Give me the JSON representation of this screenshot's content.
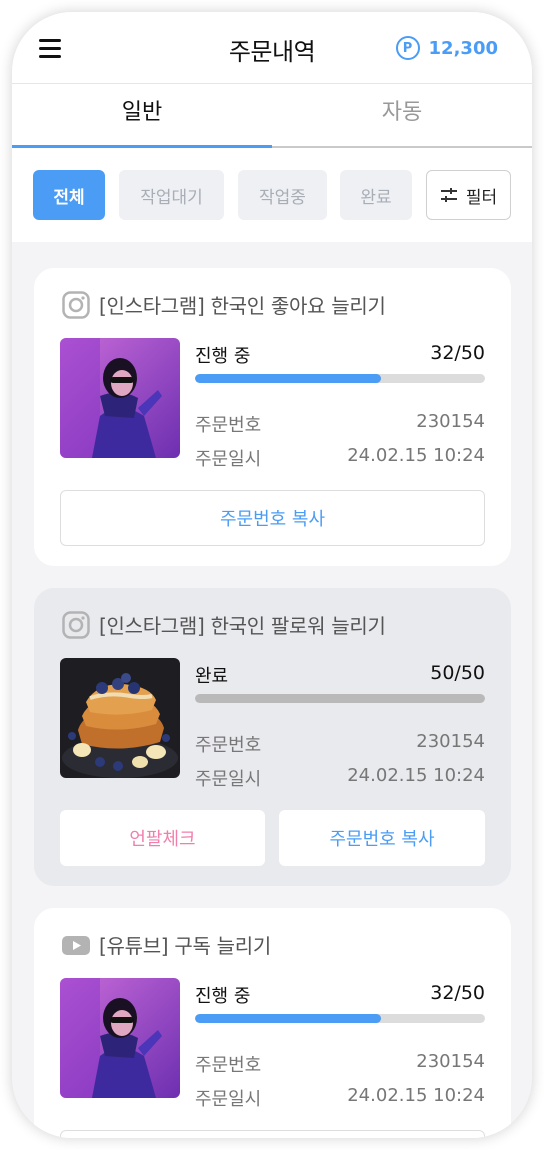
{
  "header": {
    "title": "주문내역",
    "points_icon": "P",
    "points": "12,300"
  },
  "tabs": [
    {
      "label": "일반",
      "active": true
    },
    {
      "label": "자동",
      "active": false
    }
  ],
  "filters": {
    "chips": [
      {
        "label": "전체",
        "active": true
      },
      {
        "label": "작업대기",
        "active": false
      },
      {
        "label": "작업중",
        "active": false
      },
      {
        "label": "완료",
        "active": false
      }
    ],
    "filter_label": "필터"
  },
  "orders": [
    {
      "platform_icon": "instagram-icon",
      "title": "[인스타그램] 한국인 좋아요 늘리기",
      "status": "진행 중",
      "count": "32/50",
      "progress": 0.64,
      "progress_color": "#4a9cf5",
      "order_no_label": "주문번호",
      "order_no": "230154",
      "order_date_label": "주문일시",
      "order_date": "24.02.15 10:24",
      "copy_label": "주문번호 복사"
    },
    {
      "platform_icon": "instagram-icon",
      "title": "[인스타그램] 한국인 팔로워 늘리기",
      "status": "완료",
      "count": "50/50",
      "progress": 1.0,
      "progress_color": "#b9b9b9",
      "order_no_label": "주문번호",
      "order_no": "230154",
      "order_date_label": "주문일시",
      "order_date": "24.02.15 10:24",
      "unfollow_label": "언팔체크",
      "copy_label": "주문번호 복사"
    },
    {
      "platform_icon": "youtube-icon",
      "title": "[유튜브] 구독 늘리기",
      "status": "진행 중",
      "count": "32/50",
      "progress": 0.64,
      "progress_color": "#4a9cf5",
      "order_no_label": "주문번호",
      "order_no": "230154",
      "order_date_label": "주문일시",
      "order_date": "24.02.15 10:24"
    }
  ],
  "colors": {
    "accent": "#4a9cf5",
    "unfollow": "#f07fae",
    "muted": "#a9aeb6"
  }
}
